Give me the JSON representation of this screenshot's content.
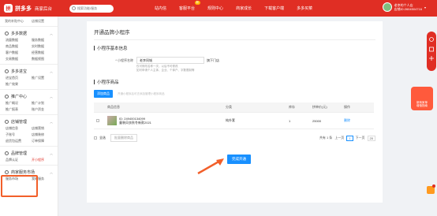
{
  "topbar": {
    "logo_mark": "拼",
    "logo_text": "拼多多",
    "logo_sub": "商家后台",
    "search_placeholder": "搜索功能/服务",
    "nav": [
      {
        "label": "站内信"
      },
      {
        "label": "客服平台",
        "badge": "新"
      },
      {
        "label": "规则中心"
      },
      {
        "label": "商家成长"
      },
      {
        "label": "下载客户端"
      },
      {
        "label": "多多买菜"
      }
    ],
    "user_name": "老李的个人店",
    "user_id": "店铺ID:2604504716",
    "brand_color": "#e02e24"
  },
  "sidebar": {
    "top_links": [
      "我的补贴中心",
      "店铺设置"
    ],
    "groups": [
      {
        "title": "多多数据",
        "items": [
          "流量数据",
          "服务数据",
          "商品数据",
          "实时数据",
          "客户数据",
          "经营数据",
          "交易数据",
          "数据视图"
        ]
      },
      {
        "title": "多多进宝",
        "items": [
          "进宝首页",
          "推广设置",
          "推广效果"
        ]
      },
      {
        "title": "推广中心",
        "items": [
          "推广概况",
          "推广计划",
          "推广报表",
          "账户资金"
        ]
      },
      {
        "title": "店铺管理",
        "items": [
          "店铺信息",
          "店铺营销",
          "子账号",
          "店铺装修",
          "退货包运费",
          "订单保障"
        ]
      },
      {
        "title": "品牌管理",
        "items": [
          "品牌认证",
          "开小程序"
        ],
        "active_index": 1
      },
      {
        "title": "商家服务市场",
        "items": [
          "服务市场",
          "我的服务"
        ]
      }
    ]
  },
  "main": {
    "page_title": "开通品牌小程序",
    "section_basic": "小程序基本信息",
    "name_label": "* 小程序名称",
    "name_value": "老李同城",
    "name_suffix": "旗下门店",
    "hint_line1": "仅可修改名称一次，以后不可修改",
    "hint_line2": "如可申请个人主体、企业、个体户、字数限制等",
    "section_goods": "小程序商品",
    "add_button": "添加商品",
    "add_hint": "开通小程序后可去添加管理小程序商品",
    "table": {
      "headers": [
        "",
        "商品信息",
        "分类",
        "库存",
        "拼单价(元)",
        "操作"
      ],
      "rows": [
        {
          "id": "ID: 249400134099",
          "title": "童装风衣秋冬新款2021",
          "category": "纯外套",
          "stock": "1",
          "price": "25000",
          "action": "删除"
        }
      ]
    },
    "select_all": "全选",
    "batch_delete": "批量删除商品",
    "pager_total": "共有 1 条",
    "pager_prev": "上一页",
    "pager_page": "1",
    "pager_next": "下一页",
    "pager_size": "20",
    "submit": "完成开通"
  },
  "widgets": {
    "promo_line1": "新商家单",
    "promo_line2": "增值指南"
  }
}
